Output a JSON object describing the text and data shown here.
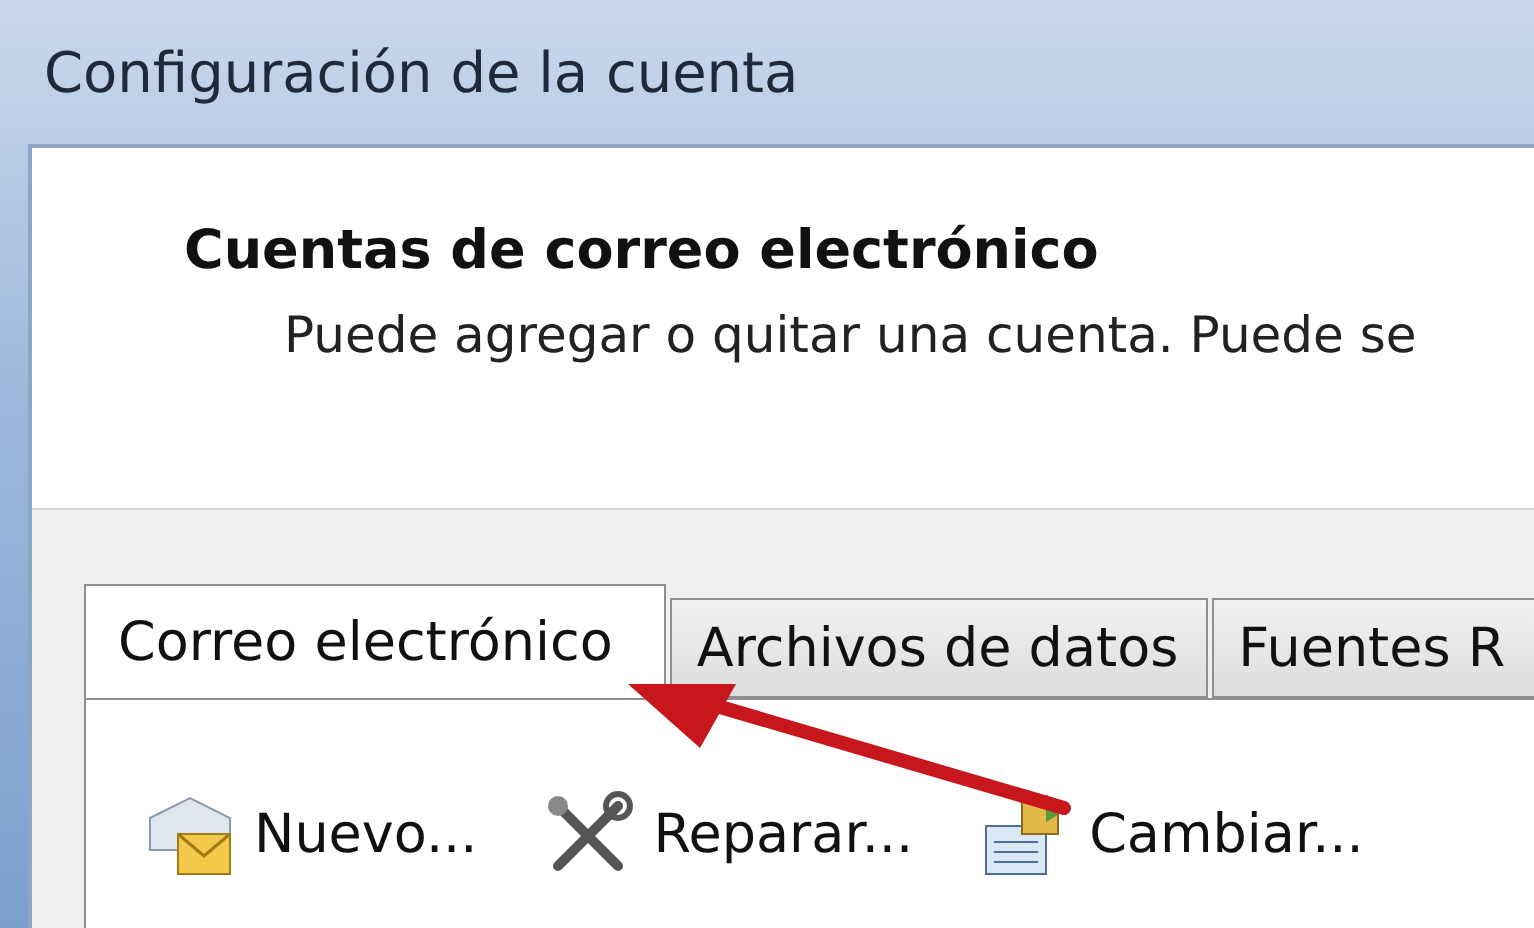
{
  "window": {
    "title": "Configuración de la cuenta"
  },
  "header": {
    "title": "Cuentas de correo electrónico",
    "description": "Puede agregar o quitar una cuenta. Puede se"
  },
  "tabs": [
    {
      "label": "Correo electrónico",
      "selected": true
    },
    {
      "label": "Archivos de datos",
      "selected": false
    },
    {
      "label": "Fuentes R",
      "selected": false
    }
  ],
  "toolbar": [
    {
      "kind": "new",
      "label": "Nuevo..."
    },
    {
      "kind": "repair",
      "label": "Reparar..."
    },
    {
      "kind": "change",
      "label": "Cambiar..."
    }
  ]
}
